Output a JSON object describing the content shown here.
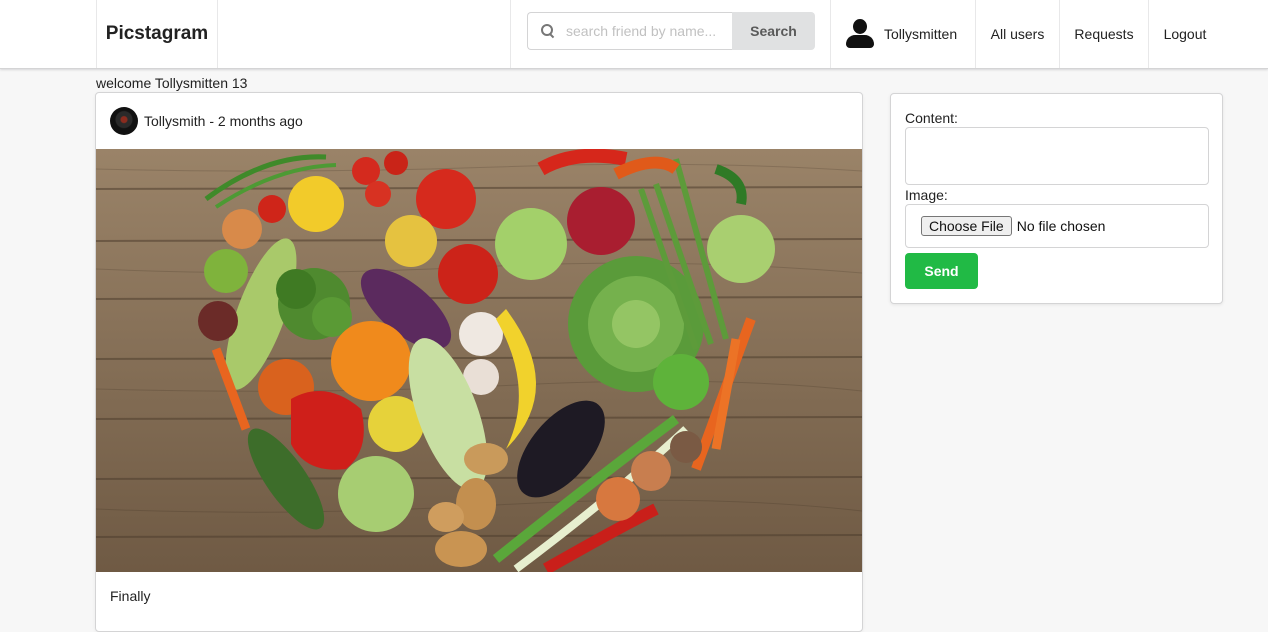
{
  "navbar": {
    "brand": "Picstagram",
    "search": {
      "placeholder": "search friend by name...",
      "button_label": "Search",
      "icon": "search-icon"
    },
    "user": {
      "name": "Tollysmitten",
      "icon": "user-avatar-icon"
    },
    "links": {
      "all_users": "All users",
      "requests": "Requests",
      "logout": "Logout"
    }
  },
  "welcome_text": "welcome Tollysmitten 13",
  "post": {
    "author_meta": "Tollysmith - 2 months ago",
    "image_subject": "vegetables-heart-on-wooden-table",
    "caption": "Finally"
  },
  "new_post_form": {
    "content_label": "Content:",
    "image_label": "Image:",
    "file_button": "Choose File",
    "file_status": "No file chosen",
    "send_label": "Send"
  },
  "colors": {
    "accent_green": "#21ba45",
    "search_button": "#e0e1e2",
    "page_bg": "#f7f7f7"
  }
}
